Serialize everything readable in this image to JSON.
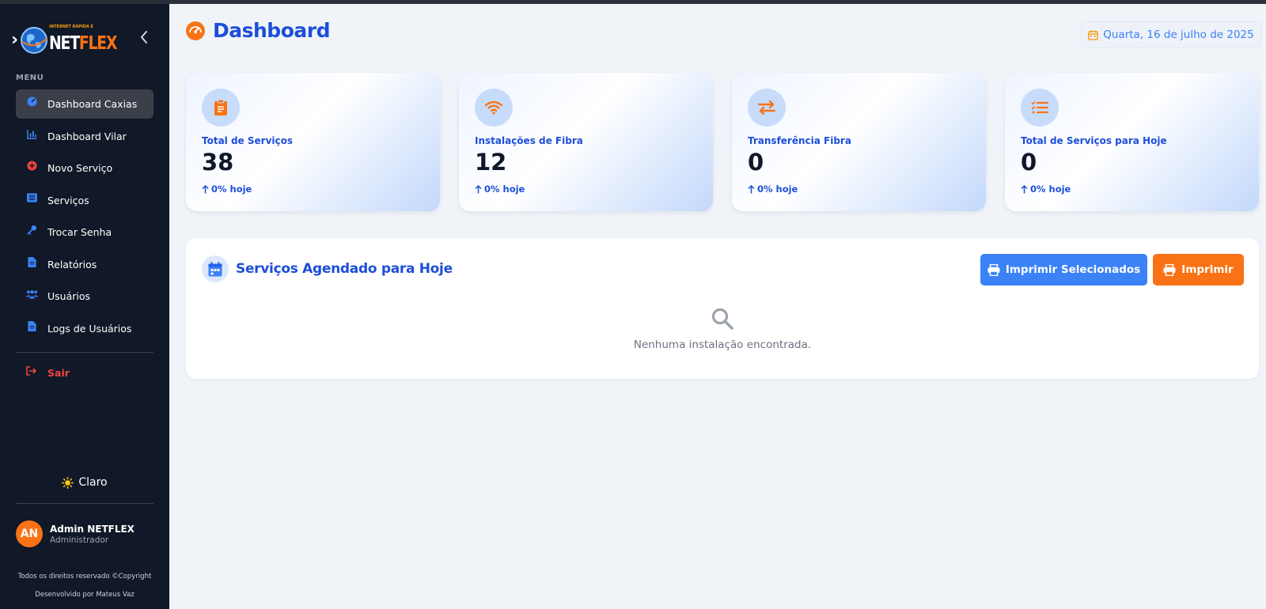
{
  "brand": {
    "tagline": "INTERNET RÁPIDA E",
    "name_part1": "NET",
    "name_part2": "FLEX"
  },
  "sidebar": {
    "menu_title": "MENU",
    "items": [
      {
        "label": "Dashboard Caxias",
        "icon": "gauge-icon",
        "active": true
      },
      {
        "label": "Dashboard Vilar",
        "icon": "bar-chart-icon",
        "active": false
      },
      {
        "label": "Novo Serviço",
        "icon": "plus-circle-icon",
        "active": false
      },
      {
        "label": "Serviços",
        "icon": "list-icon",
        "active": false
      },
      {
        "label": "Trocar Senha",
        "icon": "key-icon",
        "active": false
      },
      {
        "label": "Relatórios",
        "icon": "file-icon",
        "active": false
      },
      {
        "label": "Usuários",
        "icon": "users-icon",
        "active": false
      },
      {
        "label": "Logs de Usuários",
        "icon": "file-log-icon",
        "active": false
      }
    ],
    "logout_label": "Sair",
    "theme_label": "Claro",
    "user": {
      "initials": "AN",
      "name": "Admin NETFLEX",
      "role": "Administrador"
    },
    "copyright_line1": "Todos os direitos reservado ©Copyright",
    "copyright_line2": "Desenvolvido por Mateus Vaz"
  },
  "header": {
    "title": "Dashboard",
    "date": "Quarta, 16 de julho de 2025"
  },
  "cards": [
    {
      "title": "Total de Serviços",
      "value": "38",
      "delta": "0% hoje",
      "icon": "clipboard-icon"
    },
    {
      "title": "Instalações de Fibra",
      "value": "12",
      "delta": "0% hoje",
      "icon": "wifi-icon"
    },
    {
      "title": "Transferência Fibra",
      "value": "0",
      "delta": "0% hoje",
      "icon": "transfer-icon"
    },
    {
      "title": "Total de Serviços para Hoje",
      "value": "0",
      "delta": "0% hoje",
      "icon": "checklist-icon"
    }
  ],
  "panel": {
    "title": "Serviços Agendado para Hoje",
    "print_selected_label": "Imprimir Selecionados",
    "print_label": "Imprimir",
    "empty_text": "Nenhuma instalação encontrada."
  },
  "colors": {
    "sidebar_bg": "#111827",
    "primary": "#1d4ed8",
    "accent_blue": "#3b82f6",
    "accent_orange": "#f97316",
    "logout_red": "#ef4444"
  }
}
